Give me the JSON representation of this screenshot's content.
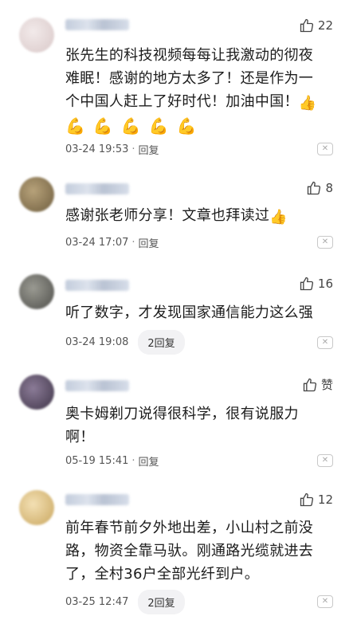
{
  "comments": [
    {
      "avatar_color": "#e8dcdc",
      "likes": "22",
      "text_lines": [
        "张先生的科技视频每每让我激动的彻夜",
        "难眠！感谢的地方太多了！还是作为一",
        "个中国人赶上了好时代！加油中国！"
      ],
      "muscle_emojis": [
        "💪",
        "💪",
        "💪",
        "💪",
        "💪"
      ],
      "timestamp": "03-24 19:53",
      "reply_label": "回复"
    },
    {
      "avatar_color": "#8a7a5a",
      "likes": "8",
      "text_lines": [
        "感谢张老师分享！文章也拜读过"
      ],
      "timestamp": "03-24 17:07",
      "reply_label": "回复"
    },
    {
      "avatar_color": "#6f6f6a",
      "likes": "16",
      "text_lines": [
        "听了数字，才发现国家通信能力这么强"
      ],
      "timestamp": "03-24 19:08",
      "reply_pill": "2回复"
    },
    {
      "avatar_color": "#5b4f66",
      "likes": "赞",
      "text_lines": [
        "奥卡姆剃刀说得很科学，很有说服力",
        "啊！"
      ],
      "timestamp": "05-19 15:41",
      "reply_label": "回复"
    },
    {
      "avatar_color": "#e6c98a",
      "likes": "12",
      "text_lines": [
        "前年春节前夕外地出差，小山村之前没",
        "路，物资全靠马驮。刚通路光缆就进去",
        "了，全村36户全部光纤到户。"
      ],
      "timestamp": "03-25 12:47",
      "reply_pill": "2回复"
    }
  ]
}
